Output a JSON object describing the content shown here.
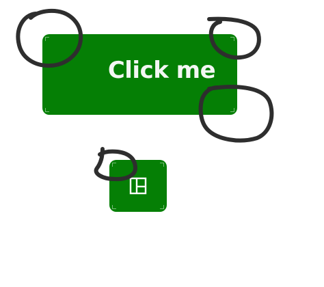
{
  "main_button": {
    "label": "Click me",
    "background": "#057f05",
    "text_color": "#f3f7f3"
  },
  "icon_button": {
    "icon": "layout-panels-icon",
    "background": "#057f05",
    "icon_color": "#ffffff"
  },
  "annotations": {
    "stroke_color": "#2e2e2e",
    "circle_count": 4
  }
}
